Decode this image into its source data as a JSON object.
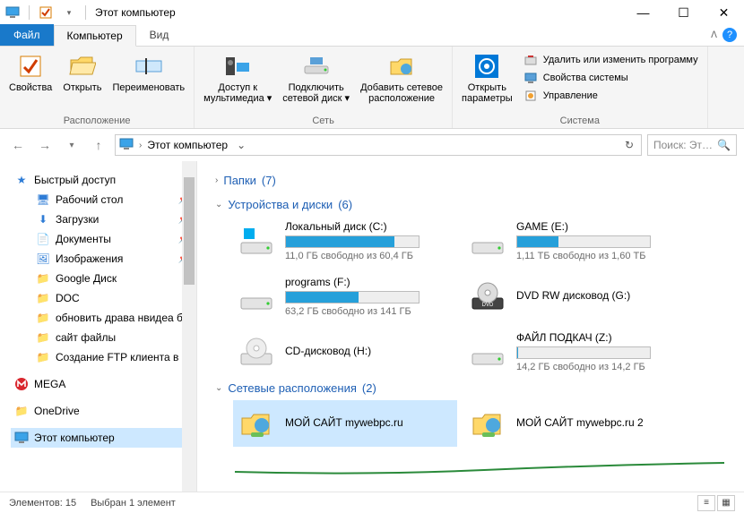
{
  "titlebar": {
    "title": "Этот компьютер"
  },
  "wincontrols": {
    "min": "—",
    "max": "☐",
    "close": "✕"
  },
  "tabs": {
    "file": "Файл",
    "computer": "Компьютер",
    "view": "Вид"
  },
  "ribbon": {
    "group_location": {
      "label": "Расположение",
      "properties": "Свойства",
      "open": "Открыть",
      "rename": "Переименовать"
    },
    "group_network": {
      "label": "Сеть",
      "media": "Доступ к\nмультимедиа",
      "map_drive": "Подключить\nсетевой диск",
      "add_net": "Добавить сетевое\nрасположение"
    },
    "group_system": {
      "label": "Система",
      "open_params": "Открыть\nпараметры",
      "uninstall": "Удалить или изменить программу",
      "sys_props": "Свойства системы",
      "manage": "Управление"
    }
  },
  "address": {
    "path": "Этот компьютер"
  },
  "search": {
    "placeholder": "Поиск: Эт…"
  },
  "nav": {
    "quick": {
      "label": "Быстрый доступ",
      "items": [
        "Рабочий стол",
        "Загрузки",
        "Документы",
        "Изображения",
        "Google Диск",
        "DOC",
        "обновить драва нвидеа без л",
        "сайт файлы",
        "Создание FTP клиента в про"
      ]
    },
    "mega": "MEGA",
    "onedrive": "OneDrive",
    "thispc": "Этот компьютер"
  },
  "sections": {
    "folders": {
      "label": "Папки",
      "count": 7
    },
    "devices": {
      "label": "Устройства и диски",
      "count": 6
    },
    "netloc": {
      "label": "Сетевые расположения",
      "count": 2
    }
  },
  "drives": [
    {
      "name": "Локальный диск (C:)",
      "free": "11,0 ГБ свободно из 60,4 ГБ",
      "fill": 82,
      "type": "hdd-win"
    },
    {
      "name": "GAME (E:)",
      "free": "1,11 ТБ свободно из 1,60 ТБ",
      "fill": 31,
      "type": "hdd"
    },
    {
      "name": "programs (F:)",
      "free": "63,2 ГБ свободно из 141 ГБ",
      "fill": 55,
      "type": "hdd"
    },
    {
      "name": "DVD RW дисковод (G:)",
      "free": "",
      "fill": 0,
      "type": "dvd"
    },
    {
      "name": "CD-дисковод (H:)",
      "free": "",
      "fill": 0,
      "type": "cd"
    },
    {
      "name": "ФАЙЛ ПОДКАЧ (Z:)",
      "free": "14,2 ГБ свободно из 14,2 ГБ",
      "fill": 1,
      "type": "hdd"
    }
  ],
  "netlocs": [
    {
      "name": "МОЙ САЙТ mywebpc.ru"
    },
    {
      "name": "МОЙ САЙТ mywebpc.ru 2"
    }
  ],
  "status": {
    "elements": "Элементов: 15",
    "selected": "Выбран 1 элемент"
  }
}
